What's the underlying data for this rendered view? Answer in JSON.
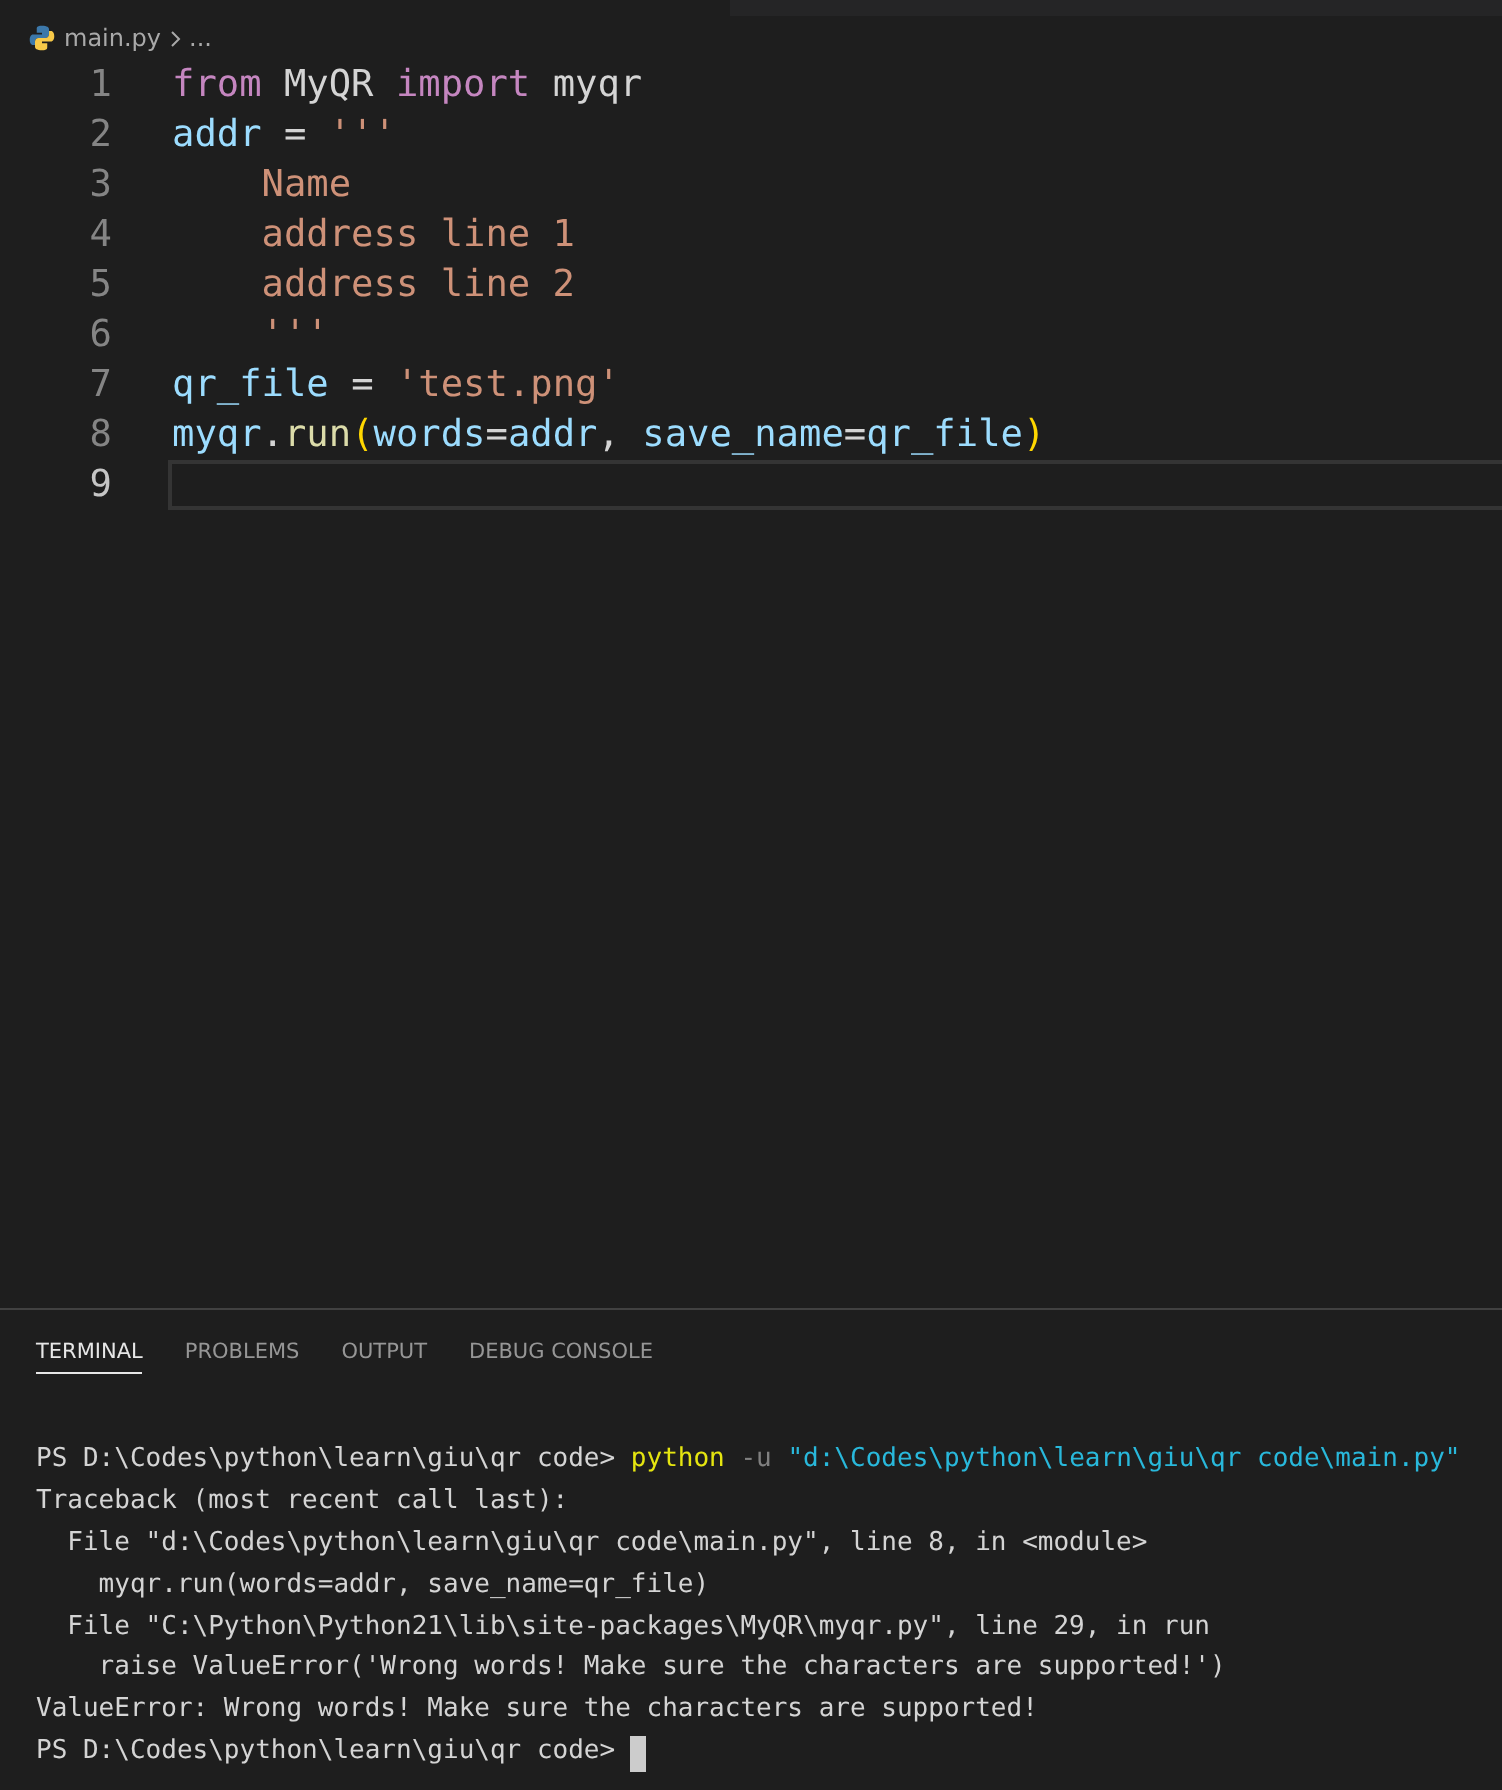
{
  "breadcrumb": {
    "file": "main.py",
    "rest": "..."
  },
  "editor": {
    "lines": [
      {
        "number": "1",
        "active": false,
        "tokens": [
          {
            "kind": "keyword",
            "text": "from"
          },
          {
            "kind": "plain",
            "text": " MyQR "
          },
          {
            "kind": "keyword",
            "text": "import"
          },
          {
            "kind": "plain",
            "text": " myqr"
          }
        ]
      },
      {
        "number": "2",
        "active": false,
        "tokens": [
          {
            "kind": "variable",
            "text": "addr"
          },
          {
            "kind": "plain",
            "text": " = "
          },
          {
            "kind": "string",
            "text": "'''"
          }
        ]
      },
      {
        "number": "3",
        "active": false,
        "tokens": [
          {
            "kind": "string",
            "text": "    Name"
          }
        ]
      },
      {
        "number": "4",
        "active": false,
        "tokens": [
          {
            "kind": "string",
            "text": "    address line 1"
          }
        ]
      },
      {
        "number": "5",
        "active": false,
        "tokens": [
          {
            "kind": "string",
            "text": "    address line 2"
          }
        ]
      },
      {
        "number": "6",
        "active": false,
        "tokens": [
          {
            "kind": "string",
            "text": "    '''"
          }
        ]
      },
      {
        "number": "7",
        "active": false,
        "tokens": [
          {
            "kind": "variable",
            "text": "qr_file"
          },
          {
            "kind": "plain",
            "text": " = "
          },
          {
            "kind": "string",
            "text": "'test.png'"
          }
        ]
      },
      {
        "number": "8",
        "active": false,
        "tokens": [
          {
            "kind": "variable",
            "text": "myqr"
          },
          {
            "kind": "plain",
            "text": "."
          },
          {
            "kind": "function",
            "text": "run"
          },
          {
            "kind": "bracket",
            "text": "("
          },
          {
            "kind": "variable",
            "text": "words"
          },
          {
            "kind": "plain",
            "text": "="
          },
          {
            "kind": "variable",
            "text": "addr"
          },
          {
            "kind": "plain",
            "text": ", "
          },
          {
            "kind": "variable",
            "text": "save_name"
          },
          {
            "kind": "plain",
            "text": "="
          },
          {
            "kind": "variable",
            "text": "qr_file"
          },
          {
            "kind": "bracket",
            "text": ")"
          }
        ]
      },
      {
        "number": "9",
        "active": true
      }
    ]
  },
  "panel": {
    "tabs": [
      {
        "label": "TERMINAL",
        "selected": true
      },
      {
        "label": "PROBLEMS",
        "selected": false
      },
      {
        "label": "OUTPUT",
        "selected": false
      },
      {
        "label": "DEBUG CONSOLE",
        "selected": false
      }
    ],
    "terminal": [
      {
        "cursor": false,
        "tokens": [
          {
            "kind": "plain",
            "text": "PS D:\\Codes\\python\\learn\\giu\\qr code> "
          },
          {
            "kind": "command",
            "text": "python"
          },
          {
            "kind": "flag",
            "text": " -u "
          },
          {
            "kind": "path",
            "text": "\"d:\\Codes\\python\\learn\\giu\\qr code\\main.py\""
          }
        ]
      },
      {
        "cursor": false,
        "tokens": [
          {
            "kind": "plain",
            "text": "Traceback (most recent call last):"
          }
        ]
      },
      {
        "cursor": false,
        "tokens": [
          {
            "kind": "plain",
            "text": "  File \"d:\\Codes\\python\\learn\\giu\\qr code\\main.py\", line 8, in <module>"
          }
        ]
      },
      {
        "cursor": false,
        "tokens": [
          {
            "kind": "plain",
            "text": "    myqr.run(words=addr, save_name=qr_file)"
          }
        ]
      },
      {
        "cursor": false,
        "tokens": [
          {
            "kind": "plain",
            "text": "  File \"C:\\Python\\Python21\\lib\\site-packages\\MyQR\\myqr.py\", line 29, in run"
          }
        ]
      },
      {
        "cursor": false,
        "tokens": [
          {
            "kind": "plain",
            "text": "    raise ValueError('Wrong words! Make sure the characters are supported!')"
          }
        ]
      },
      {
        "cursor": false,
        "tokens": [
          {
            "kind": "plain",
            "text": "ValueError: Wrong words! Make sure the characters are supported!"
          }
        ]
      },
      {
        "cursor": true,
        "tokens": [
          {
            "kind": "plain",
            "text": "PS D:\\Codes\\python\\learn\\giu\\qr code> "
          }
        ]
      }
    ]
  }
}
